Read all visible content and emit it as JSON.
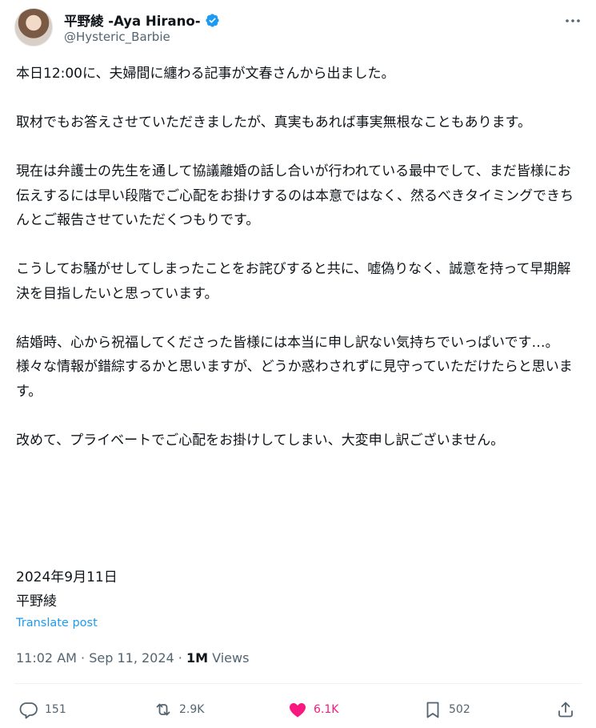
{
  "user": {
    "display_name": "平野綾 -Aya Hirano-",
    "handle": "@Hysteric_Barbie"
  },
  "post": {
    "paragraphs": [
      "本日12:00に、夫婦間に纏わる記事が文春さんから出ました。",
      "取材でもお答えさせていただきましたが、真実もあれば事実無根なこともあります。",
      "現在は弁護士の先生を通して協議離婚の話し合いが行われている最中でして、まだ皆様にお伝えするには早い段階でご心配をお掛けするのは本意ではなく、然るべきタイミングできちんとご報告させていただくつもりです。",
      "こうしてお騒がせしてしまったことをお詫びすると共に、嘘偽りなく、誠意を持って早期解決を目指したいと思っています。",
      "結婚時、心から祝福してくださった皆様には本当に申し訳ない気持ちでいっぱいです…。\n様々な情報が錯綜するかと思いますが、どうか惑わされずに見守っていただけたらと思います。",
      "改めて、プライベートでご心配をお掛けしてしまい、大変申し訳ございません。"
    ],
    "date_line": "2024年9月11日",
    "signature": "平野綾",
    "translate_label": "Translate post",
    "time": "11:02 AM",
    "date": "Sep 11, 2024",
    "views_count": "1M",
    "views_label": "Views"
  },
  "actions": {
    "replies": "151",
    "reposts": "2.9K",
    "likes": "6.1K",
    "bookmarks": "502"
  },
  "colors": {
    "text": "#0f1419",
    "secondary": "#536471",
    "accent": "#1d9bf0",
    "like": "#f91880"
  },
  "icons": [
    "verified-badge-icon",
    "more-icon",
    "reply-icon",
    "repost-icon",
    "like-icon",
    "bookmark-icon",
    "share-icon"
  ]
}
